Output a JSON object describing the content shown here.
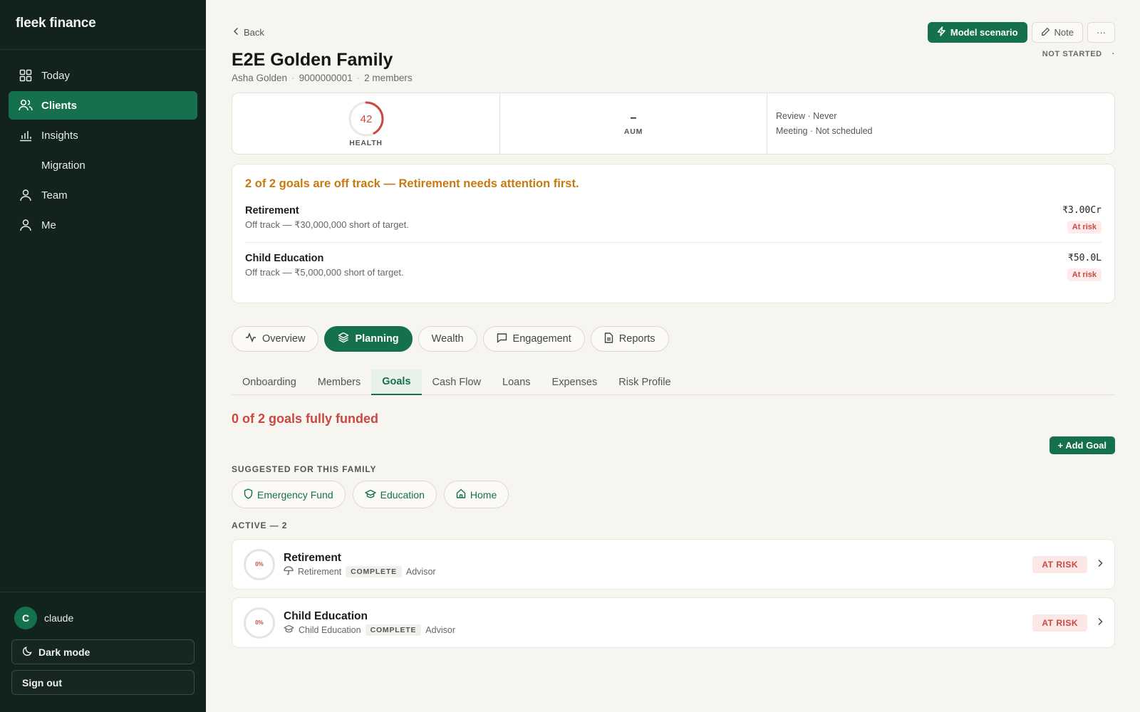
{
  "app": {
    "brand": "fleek finance"
  },
  "sidebar": {
    "items": [
      {
        "label": "Today",
        "icon": "grid-icon"
      },
      {
        "label": "Clients",
        "icon": "users-icon",
        "active": true
      },
      {
        "label": "Insights",
        "icon": "bar-chart-icon"
      },
      {
        "label": "Migration",
        "icon": ""
      },
      {
        "label": "Team",
        "icon": "user-icon"
      },
      {
        "label": "Me",
        "icon": "user-icon"
      }
    ],
    "user": {
      "initial": "C",
      "name": "claude"
    },
    "dark_mode_label": "Dark mode",
    "sign_out_label": "Sign out"
  },
  "header": {
    "back_label": "Back",
    "model_scenario_label": "Model scenario",
    "note_label": "Note",
    "more_label": "···",
    "status": "NOT STARTED",
    "status_dot": "·",
    "family_name": "E2E Golden Family",
    "primary_contact": "Asha Golden",
    "phone": "9000000001",
    "members": "2 members"
  },
  "summary": {
    "health_value": "42",
    "health_score": 42,
    "health_label": "HEALTH",
    "aum_value": "–",
    "aum_label": "AUM",
    "review": "Review · Never",
    "meeting": "Meeting · Not scheduled"
  },
  "alert": {
    "title": "2 of 2 goals are off track — Retirement needs attention first.",
    "goals": [
      {
        "name": "Retirement",
        "sub": "Off track — ₹30,000,000 short of target.",
        "amount": "₹3.00Cr",
        "status": "At risk"
      },
      {
        "name": "Child Education",
        "sub": "Off track — ₹5,000,000 short of target.",
        "amount": "₹50.0L",
        "status": "At risk"
      }
    ]
  },
  "main_tabs": [
    {
      "label": "Overview",
      "icon": "activity-icon"
    },
    {
      "label": "Planning",
      "icon": "layers-icon",
      "active": true
    },
    {
      "label": "Wealth",
      "icon": ""
    },
    {
      "label": "Engagement",
      "icon": "chat-icon"
    },
    {
      "label": "Reports",
      "icon": "document-icon"
    }
  ],
  "sub_tabs": [
    {
      "label": "Onboarding"
    },
    {
      "label": "Members"
    },
    {
      "label": "Goals",
      "active": true
    },
    {
      "label": "Cash Flow"
    },
    {
      "label": "Loans"
    },
    {
      "label": "Expenses"
    },
    {
      "label": "Risk Profile"
    }
  ],
  "goals_page": {
    "funded_text": "0 of 2 goals fully funded",
    "add_goal_label": "+ Add Goal",
    "suggested_label": "SUGGESTED FOR THIS FAMILY",
    "suggestions": [
      {
        "label": "Emergency Fund",
        "icon": "shield-icon"
      },
      {
        "label": "Education",
        "icon": "graduation-cap-icon"
      },
      {
        "label": "Home",
        "icon": "home-icon"
      }
    ],
    "active_label": "ACTIVE — 2",
    "active_goals": [
      {
        "name": "Retirement",
        "percent": "0%",
        "category": "Retirement",
        "category_icon": "umbrella-icon",
        "data_status": "COMPLETE",
        "owner": "Advisor",
        "status": "AT RISK"
      },
      {
        "name": "Child Education",
        "percent": "0%",
        "category": "Child Education",
        "category_icon": "graduation-cap-icon",
        "data_status": "COMPLETE",
        "owner": "Advisor",
        "status": "AT RISK"
      }
    ]
  },
  "colors": {
    "brand_green": "#15704e",
    "sidebar_bg": "#11231c",
    "risk_red": "#c9483f",
    "warning_amber": "#c77a0e"
  }
}
